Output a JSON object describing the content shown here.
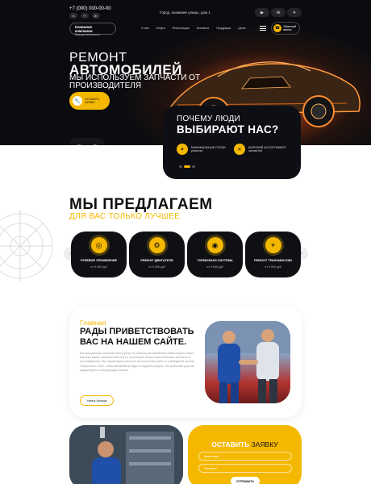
{
  "header": {
    "phone": "+7 (000) 000-00-00",
    "address": "Город, название улицы, дом 1",
    "social_icons": [
      "vk-icon",
      "telegram-icon",
      "youtube-icon"
    ],
    "top_icons": [
      "youtube-icon",
      "vk-icon",
      "telegram-icon"
    ],
    "company_name": "Название компании",
    "company_sub": "Вид деятельности",
    "nav": [
      "О нас",
      "Услуги",
      "Регистрация",
      "Контакты",
      "Продукция",
      "Цены"
    ],
    "call_label_1": "Обратный",
    "call_label_2": "звонок"
  },
  "hero": {
    "line1": "РЕМОНТ",
    "line2": "АВТОМОБИЛЕЙ",
    "line3": "МЫ ИСПОЛЬЗУЕМ ЗАПЧАСТИ ОТ ПРОИЗВОДИТЕЛЯ",
    "cta_1": "ОСТАВИТЬ",
    "cta_2": "ЗАЯВКУ",
    "prev": "←",
    "next": "→"
  },
  "why": {
    "title1": "ПОЧЕМУ ЛЮДИ",
    "title2": "ВЫБИРАЮТ НАС?",
    "features": [
      {
        "l1": "МИНИМАЛЬНЫЕ СРОКИ",
        "l2": "ремонта",
        "icon": "wrench-icon"
      },
      {
        "l1": "ШИРОКИЙ АССОРТИМЕНТ",
        "l2": "запчастей",
        "icon": "tools-icon"
      }
    ]
  },
  "offers": {
    "title": "МЫ ПРЕДЛАГАЕМ",
    "subtitle": "ДЛЯ ВАС ТОЛЬКО ЛУЧШЕЕ",
    "services": [
      {
        "name": "РУЛЕВОЕ УПРАВЛЕНИЕ",
        "price": "от 9 000 руб",
        "icon": "steering-icon"
      },
      {
        "name": "РЕМОНТ ДВИГАТЕЛЯ",
        "price": "от 9 000 руб",
        "icon": "engine-icon"
      },
      {
        "name": "ТОРМОЗНАЯ СИСТЕМА",
        "price": "от 9 000 руб",
        "icon": "brake-icon"
      },
      {
        "name": "РЕМОНТ ТРАНСМИССИИ",
        "price": "от 9 000 руб",
        "icon": "transmission-icon"
      }
    ]
  },
  "welcome": {
    "crumb": "Главная",
    "title": "РАДЫ ПРИВЕТСТВОВАТЬ ВАС НА НАШЕМ САЙТЕ.",
    "body": "Мы предлагаем широкий спектр услуг по ремонту автомобилей любых марок. Наши мастера имеют многолетний опыт и используют только оригинальные запчасти от производителя. Мы гарантируем качество выполненных работ и соблюдение сроков. Обратитесь к нам, и ваш автомобиль будет в надежных руках. Мы работаем для вас каждый день и всегда рады помочь.",
    "button": "Узнать больше"
  },
  "form": {
    "title_1": "ОСТАВИТЬ",
    "title_2": "ЗАЯВКУ",
    "name_placeholder": "Ваше имя",
    "phone_placeholder": "Телефон",
    "submit": "ОТПРАВИТЬ"
  },
  "colors": {
    "accent": "#f5b800",
    "dark": "#0e0f14"
  }
}
